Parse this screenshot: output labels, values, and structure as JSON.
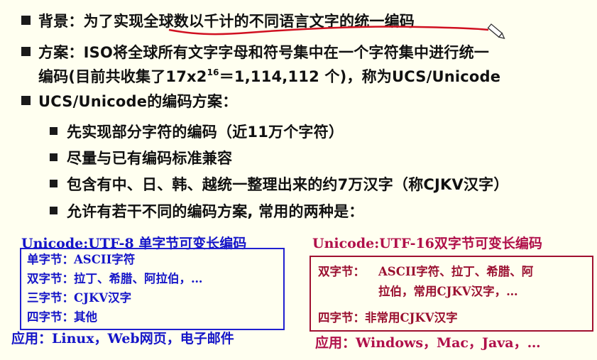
{
  "bullets": {
    "b1": {
      "label": "背景：",
      "text": "为了实现全球数以千计的不同语言文字的统一编码"
    },
    "b2": {
      "label": "方案：",
      "line1": "ISO将全球所有文字字母和符号集中在一个字符集中进行统一",
      "line2_pre": "编码(目前共收集了17x2",
      "line2_sup": "16",
      "line2_post": "＝1,114,112 个)，称为UCS/Unicode"
    },
    "b3": {
      "text": "UCS/Unicode的编码方案："
    },
    "sub": [
      "先实现部分字符的编码（近11万个字符）",
      "尽量与已有编码标准兼容",
      "包含有中、日、韩、越统一整理出来的约7万汉字（称CJKV汉字）",
      "允许有若干不同的编码方案, 常用的两种是："
    ]
  },
  "utf8": {
    "title": "Unicode:UTF-8 单字节可变长编码",
    "rows": [
      {
        "label": "单字节：",
        "value": "ASCII字符"
      },
      {
        "label": "双字节：",
        "value": "拉丁、希腊、阿拉伯，…"
      },
      {
        "label": "三字节：",
        "value": "CJKV汉字"
      },
      {
        "label": "四字节：",
        "value": "其他"
      }
    ],
    "app": "应用：Linux，Web网页，电子邮件"
  },
  "utf16": {
    "title": "Unicode:UTF-16双字节可变长编码",
    "row1_label": "双字节：",
    "row1_value1": "ASCII字符、拉丁、希腊、阿",
    "row1_value2": "拉伯，常用CJKV汉字，…",
    "row2_label": "四字节：",
    "row2_value": "非常用CJKV汉字",
    "app": "应用：Windows，Mac，Java，…"
  },
  "colors": {
    "blue": "#1515c8",
    "red": "#b0104a",
    "annotation": "#d01020",
    "background": "#fffff0"
  }
}
